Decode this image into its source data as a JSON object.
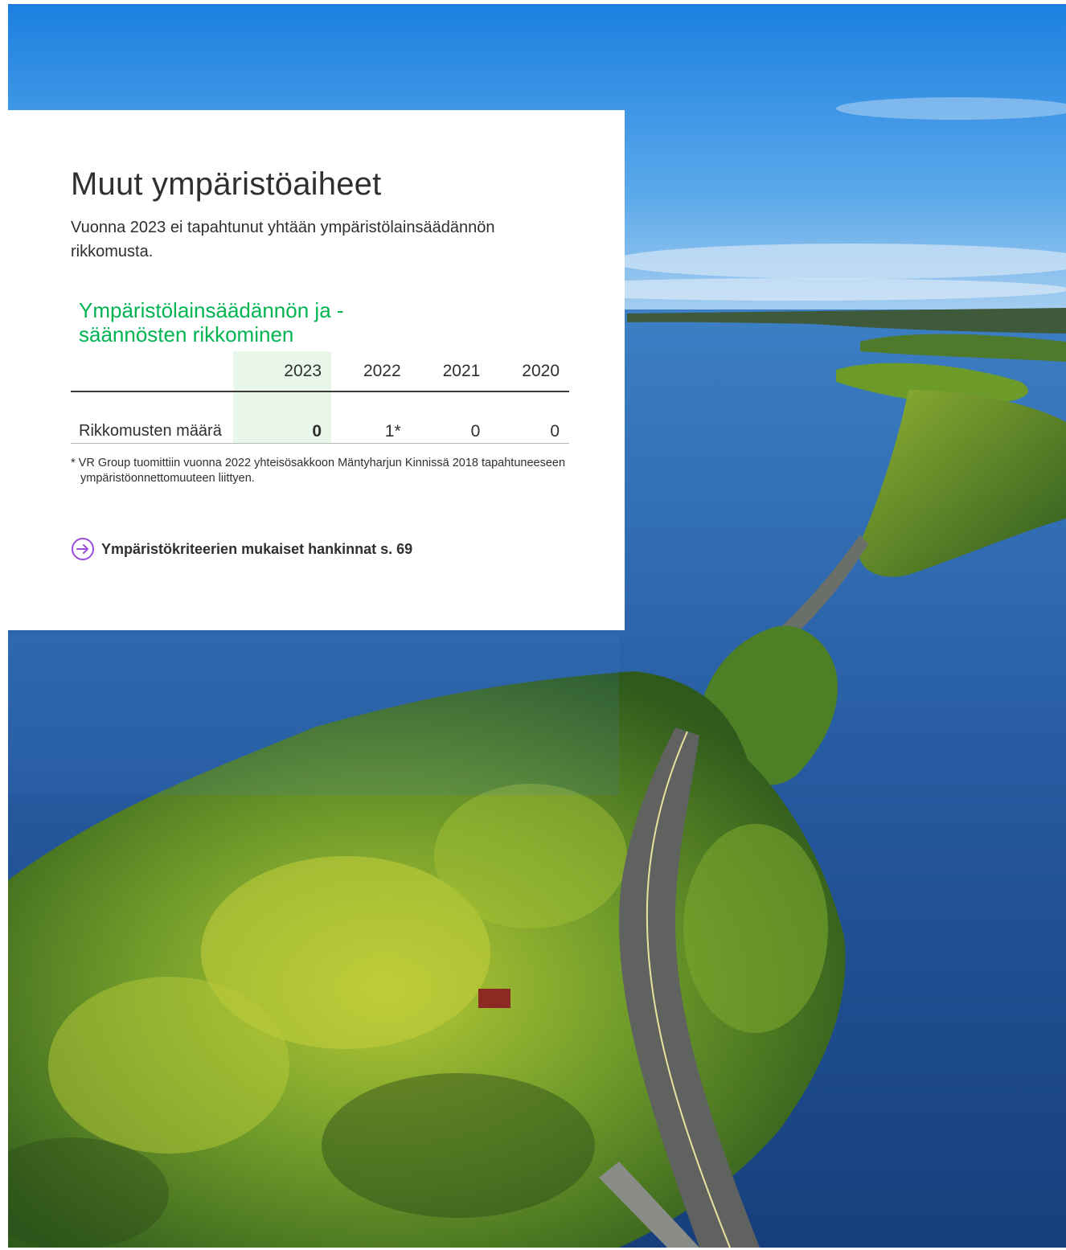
{
  "section": {
    "title": "Muut ympäristöaiheet",
    "intro": "Vuonna 2023 ei tapahtunut yhtään ympäristölainsäädännön rikkomusta."
  },
  "table": {
    "title": "Ympäristölainsäädännön ja -säännösten rikkominen",
    "columns": [
      "2023",
      "2022",
      "2021",
      "2020"
    ],
    "rows": [
      {
        "label": "Rikkomusten määrä",
        "values": [
          "0",
          "1*",
          "0",
          "0"
        ]
      }
    ],
    "footnote": "* VR Group tuomittiin vuonna 2022 yhteisösakkoon Mäntyharjun Kinnissä 2018 tapahtuneeseen ympäristöonnettomuuteen liittyen."
  },
  "link": {
    "label": "Ympäristökriteerien mukaiset hankinnat s. 69",
    "icon": "arrow-right-circle-icon",
    "icon_color": "#9b4ddb"
  },
  "photo": {
    "subject": "aerial-lake-road-image"
  },
  "colors": {
    "accent_green": "#00b451",
    "highlight_column": "#e9f7ea",
    "link_icon": "#9b4ddb"
  }
}
